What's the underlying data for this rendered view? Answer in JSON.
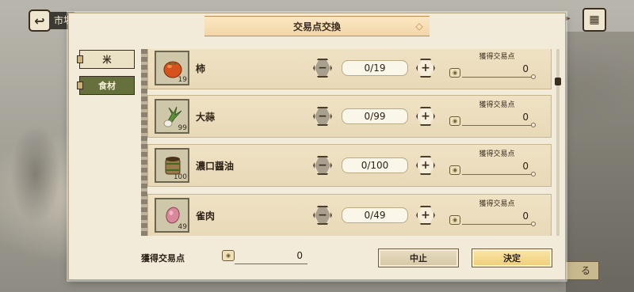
{
  "background": {
    "location_label": "市場",
    "right_button_label": "る"
  },
  "modal": {
    "title": "交易点交換",
    "tabs": [
      {
        "label": "米",
        "active": false
      },
      {
        "label": "食材",
        "active": true
      }
    ],
    "points_column_label": "獲得交易点",
    "items": [
      {
        "name": "柿",
        "stock": "19",
        "quantity": "0/19",
        "points": "0",
        "icon": "persimmon-icon"
      },
      {
        "name": "大蒜",
        "stock": "99",
        "quantity": "0/99",
        "points": "0",
        "icon": "garlic-icon"
      },
      {
        "name": "濃口醤油",
        "stock": "100",
        "quantity": "0/100",
        "points": "0",
        "icon": "soy-sauce-barrel-icon"
      },
      {
        "name": "雀肉",
        "stock": "49",
        "quantity": "0/49",
        "points": "0",
        "icon": "sparrow-meat-icon"
      }
    ],
    "footer": {
      "total_label": "獲得交易点",
      "total_value": "0",
      "cancel_label": "中止",
      "confirm_label": "決定"
    }
  },
  "colors": {
    "modal_bg": "#f2ebda",
    "active_tab": "#66703c",
    "confirm_button": "#efcd78",
    "ribbon": "#f3d6a8"
  }
}
